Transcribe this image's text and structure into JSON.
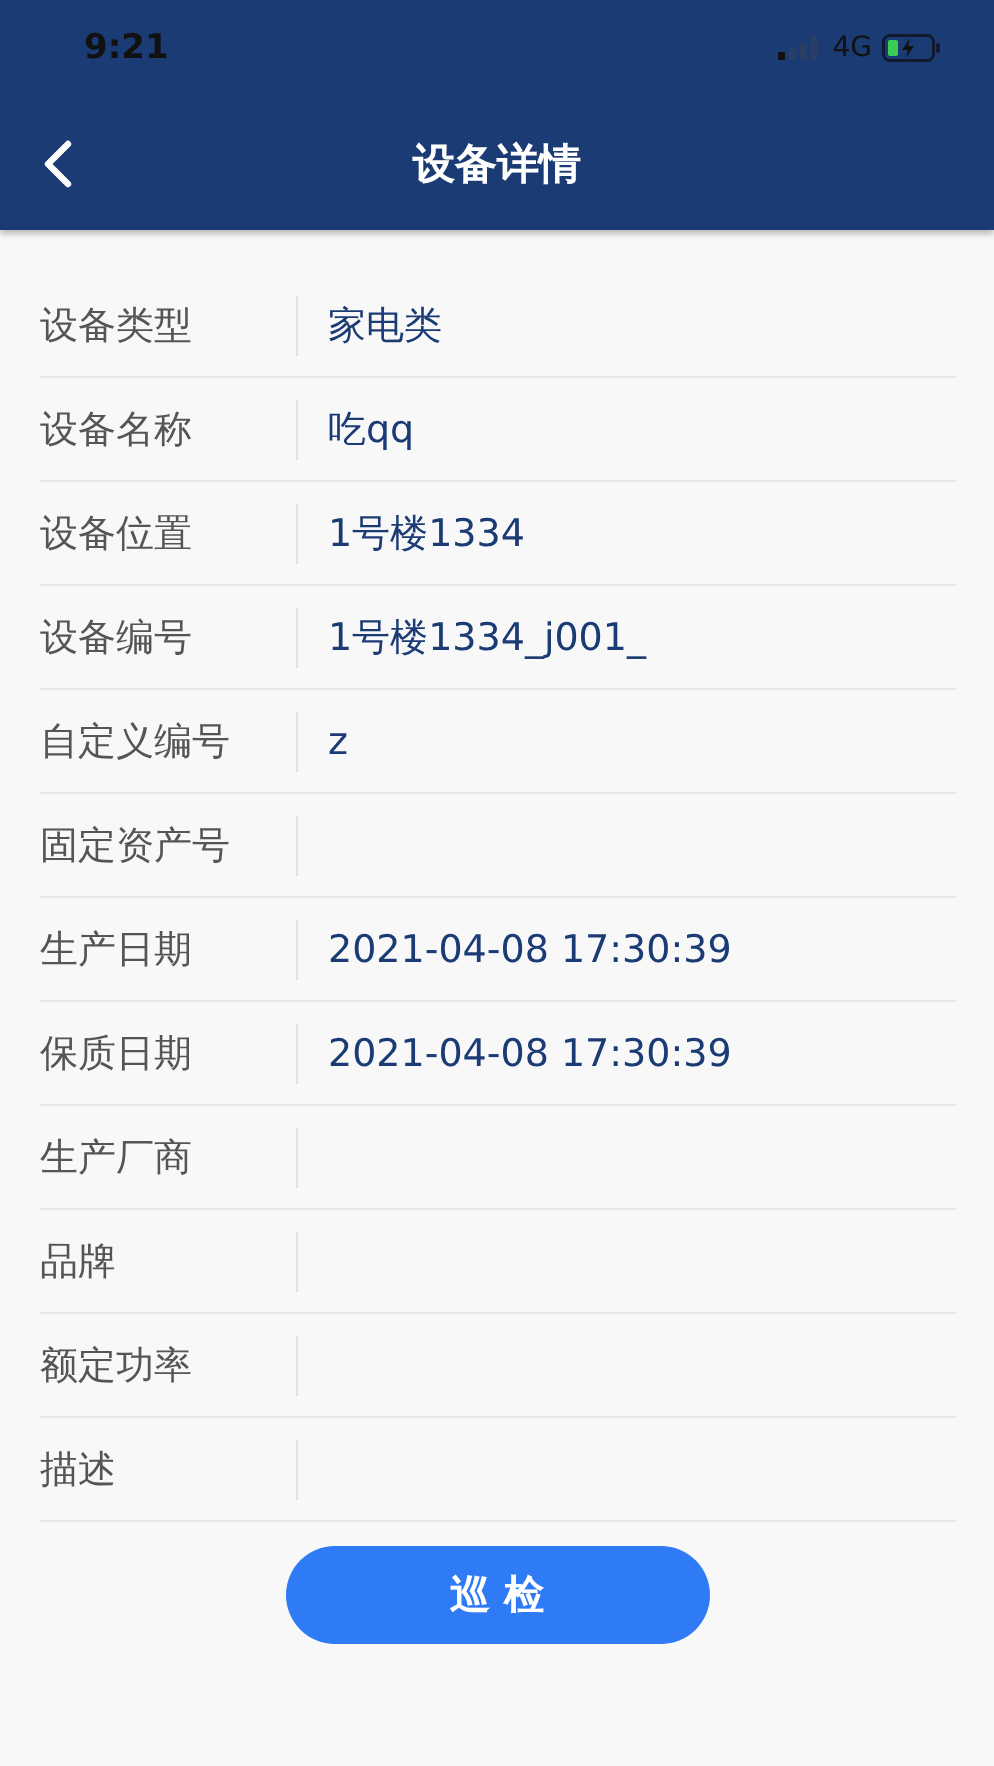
{
  "status_bar": {
    "time": "9:21",
    "network": "4G"
  },
  "nav_bar": {
    "title": "设备详情"
  },
  "fields": [
    {
      "label": "设备类型",
      "value": "家电类"
    },
    {
      "label": "设备名称",
      "value": "吃qq"
    },
    {
      "label": "设备位置",
      "value": "1号楼1334"
    },
    {
      "label": "设备编号",
      "value": "1号楼1334_j001_"
    },
    {
      "label": "自定义编号",
      "value": "z"
    },
    {
      "label": "固定资产号"
    },
    {
      "label": "生产日期",
      "value": "2021-04-08 17:30:39"
    },
    {
      "label": "保质日期",
      "value": "2021-04-08 17:30:39"
    },
    {
      "label": "生产厂商"
    },
    {
      "label": "品牌"
    },
    {
      "label": "额定功率"
    },
    {
      "label": "描述"
    }
  ],
  "action_button": {
    "label": "巡 检"
  }
}
